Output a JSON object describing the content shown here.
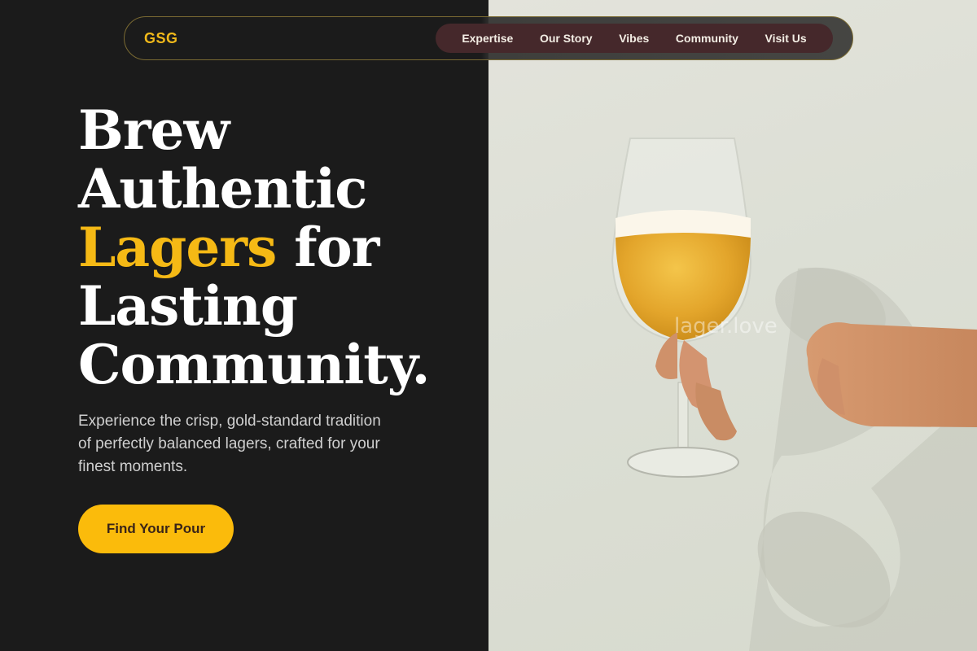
{
  "nav": {
    "brand": "GSG",
    "links": [
      "Expertise",
      "Our Story",
      "Vibes",
      "Community",
      "Visit Us"
    ]
  },
  "hero": {
    "title_line1": "Brew",
    "title_line2": "Authentic",
    "title_accent": "Lagers",
    "title_line3_rest": " for",
    "title_line4": "Lasting",
    "title_line5": "Community.",
    "description": "Experience the crisp, gold-standard tradition of perfectly balanced lagers, crafted for your finest moments.",
    "cta_label": "Find Your Pour"
  },
  "image": {
    "watermark": "lager.love"
  },
  "colors": {
    "background": "#1b1b1b",
    "accent": "#f5b915",
    "nav_pill": "#45282b"
  }
}
